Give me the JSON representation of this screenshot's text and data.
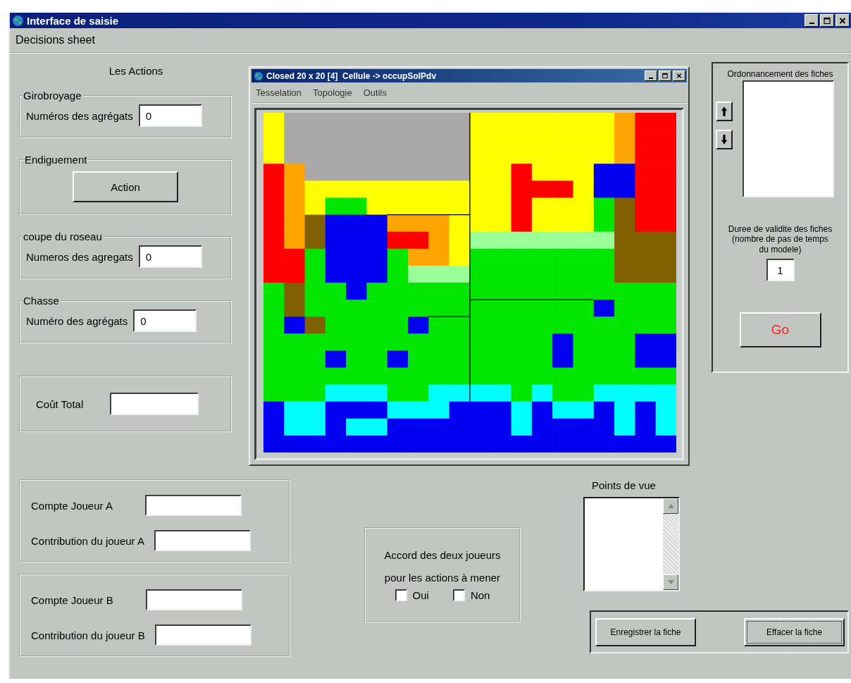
{
  "window": {
    "title": "Interface de saisie"
  },
  "menu": [
    "Decisions sheet"
  ],
  "actions": {
    "title": "Les Actions",
    "groups": [
      {
        "kind": "field",
        "legend": "Girobroyage",
        "label": "Numéros des agrégats",
        "value": "0"
      },
      {
        "kind": "button",
        "legend": "Endiguement",
        "button": "Action"
      },
      {
        "kind": "field",
        "legend": "coupe du roseau",
        "label": "Numeros des agregats",
        "value": "0"
      },
      {
        "kind": "field",
        "legend": "Chasse",
        "label": "Numéro des agrégats",
        "value": "0"
      }
    ]
  },
  "cost": {
    "label": "Coût Total"
  },
  "map_window": {
    "title": "Closed 20 x 20 [4]  Cellule -> occupSolPdv",
    "menu": [
      "Tesselation",
      "Topologie",
      "Outils"
    ]
  },
  "ordering": {
    "title": "Ordonnancement des fiches",
    "validity_label": "Duree de validite des fiches\n(nombre de pas de temps\ndu modele)",
    "validity_value": "1",
    "go_button": "Go"
  },
  "players": [
    {
      "fields": [
        {
          "label": "Compte Joueur A"
        },
        {
          "label": "Contribution du joueur A"
        }
      ]
    },
    {
      "fields": [
        {
          "label": "Compte Joueur B"
        },
        {
          "label": "Contribution du joueur B"
        }
      ]
    }
  ],
  "agreement": {
    "text": "Accord des deux joueurs pour les actions à mener",
    "options": [
      {
        "label": "Oui",
        "checked": false
      },
      {
        "label": "Non",
        "checked": false
      }
    ]
  },
  "views": {
    "label": "Points de vue"
  },
  "buttons": [
    {
      "label": "Enregistrer la fiche",
      "focused": false
    },
    {
      "label": "Effacer la fiche",
      "focused": true
    }
  ]
}
